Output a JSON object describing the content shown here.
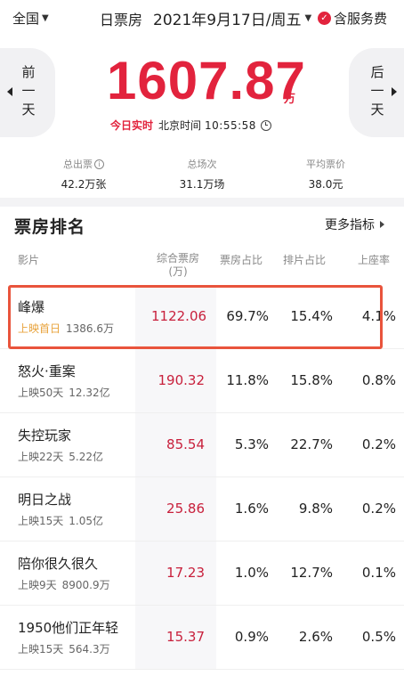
{
  "topbar": {
    "region": "全国",
    "title": "日票房",
    "date": "2021年9月17日/周五",
    "service_fee": "含服务费",
    "service_icon_label": "✓"
  },
  "nav": {
    "prev_label": "前一天",
    "next_label": "后一天"
  },
  "summary": {
    "total": "1607.87",
    "unit": "万",
    "live_label": "今日实时",
    "tz_label": "北京时间",
    "time": "10:55:58"
  },
  "stats": [
    {
      "label": "总出票",
      "value": "42.2万张",
      "has_info": true
    },
    {
      "label": "总场次",
      "value": "31.1万场",
      "has_info": false
    },
    {
      "label": "平均票价",
      "value": "38.0元",
      "has_info": false
    }
  ],
  "ranking": {
    "title": "票房排名",
    "more_label": "更多指标",
    "headers": {
      "movie": "影片",
      "gross_line1": "综合票房",
      "gross_line2": "(万)",
      "share": "票房占比",
      "schedule": "排片占比",
      "seat": "上座率"
    },
    "rows": [
      {
        "name": "峰爆",
        "tag": "上映首日",
        "total": "1386.6万",
        "gross": "1122.06",
        "share": "69.7%",
        "schedule": "15.4%",
        "seat": "4.1%",
        "highlight_tag": true
      },
      {
        "name": "怒火·重案",
        "tag": "上映50天",
        "total": "12.32亿",
        "gross": "190.32",
        "share": "11.8%",
        "schedule": "15.8%",
        "seat": "0.8%",
        "highlight_tag": false
      },
      {
        "name": "失控玩家",
        "tag": "上映22天",
        "total": "5.22亿",
        "gross": "85.54",
        "share": "5.3%",
        "schedule": "22.7%",
        "seat": "0.2%",
        "highlight_tag": false
      },
      {
        "name": "明日之战",
        "tag": "上映15天",
        "total": "1.05亿",
        "gross": "25.86",
        "share": "1.6%",
        "schedule": "9.8%",
        "seat": "0.2%",
        "highlight_tag": false
      },
      {
        "name": "陪你很久很久",
        "tag": "上映9天",
        "total": "8900.9万",
        "gross": "17.23",
        "share": "1.0%",
        "schedule": "12.7%",
        "seat": "0.1%",
        "highlight_tag": false
      },
      {
        "name": "1950他们正年轻",
        "tag": "上映15天",
        "total": "564.3万",
        "gross": "15.37",
        "share": "0.9%",
        "schedule": "2.6%",
        "seat": "0.5%",
        "highlight_tag": false
      }
    ]
  },
  "colors": {
    "accent": "#e2233d",
    "highlight_border": "#e9543c",
    "first_day_tag": "#e8a33c"
  }
}
